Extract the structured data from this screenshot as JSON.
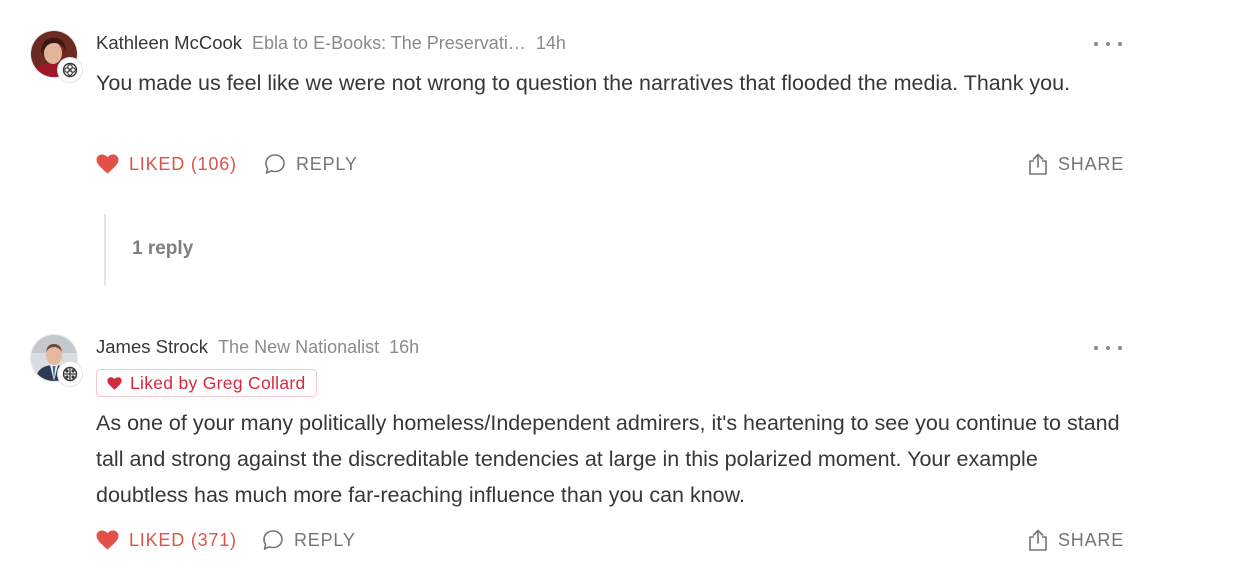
{
  "comments": [
    {
      "author": "Kathleen McCook",
      "publication": "Ebla to E-Books: The Preservati…",
      "time": "14h",
      "avatar_icon": "avatar-photo",
      "badge_icon": "subscriber-badge-icon",
      "body": "You made us feel like we were not wrong to question the narratives that flooded the media. Thank you.",
      "actions": {
        "like_label": "LIKED (106)",
        "reply_label": "REPLY",
        "share_label": "SHARE"
      },
      "thread": {
        "replies_label": "1 reply"
      }
    },
    {
      "author": "James Strock",
      "publication": "The New Nationalist",
      "time": "16h",
      "avatar_icon": "avatar-photo",
      "badge_icon": "subscriber-badge-icon",
      "liked_by_label": "Liked by Greg Collard",
      "body": "As one of your many politically homeless/Independent admirers, it's heartening to see you continue to stand tall and strong against the discreditable tendencies at large in this polarized moment. Your example doubtless has much more far-reaching influence than you can know.",
      "actions": {
        "like_label": "LIKED (371)",
        "reply_label": "REPLY",
        "share_label": "SHARE"
      }
    }
  ],
  "colors": {
    "liked": "#e0514a",
    "liked_by": "#d6283f",
    "muted": "#8a8a8a",
    "text": "#363737"
  }
}
